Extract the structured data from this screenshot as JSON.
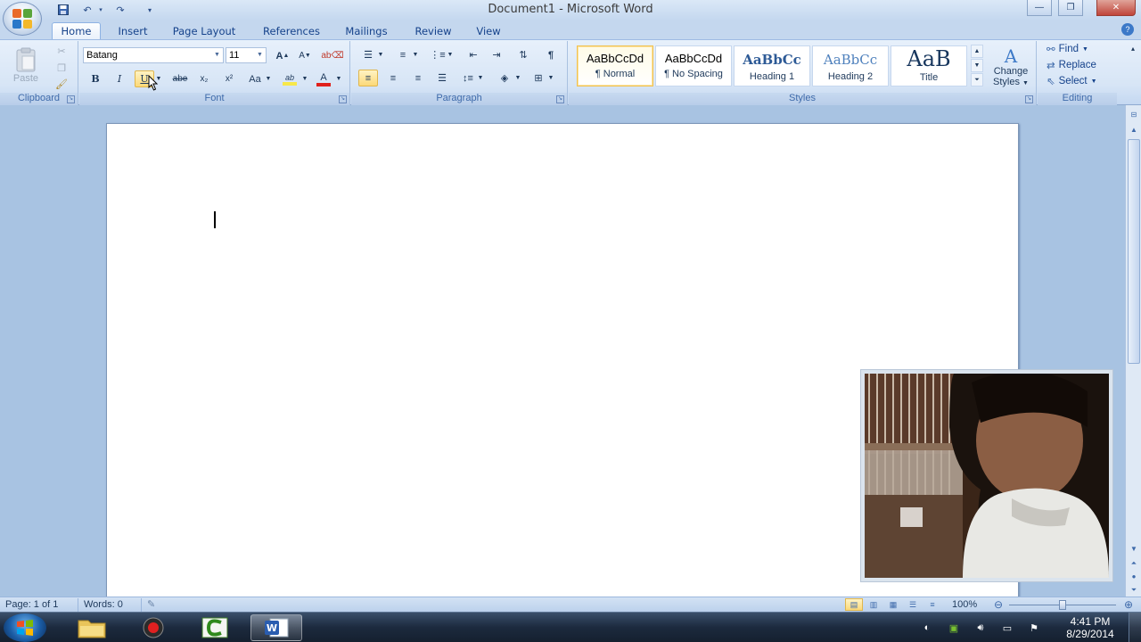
{
  "window": {
    "title": "Document1 - Microsoft Word",
    "minimize_glyph": "—",
    "restore_glyph": "❐",
    "close_glyph": "✕"
  },
  "quick_access": {
    "save_icon": "save-icon",
    "undo_icon": "undo-icon",
    "redo_icon": "redo-icon",
    "customize_icon": "chevron-down-icon"
  },
  "tabs": [
    "Home",
    "Insert",
    "Page Layout",
    "References",
    "Mailings",
    "Review",
    "View"
  ],
  "ribbon": {
    "clipboard": {
      "label": "Clipboard",
      "paste": "Paste"
    },
    "font": {
      "label": "Font",
      "font_name": "Batang",
      "font_size": "11",
      "bold": "B",
      "italic": "I",
      "underline": "U",
      "strike": "abe",
      "subscript": "x₂",
      "superscript": "x²",
      "change_case": "Aa",
      "grow": "A",
      "shrink": "A",
      "font_color_accent": "#e0201b",
      "highlight_accent": "#f7e84a"
    },
    "paragraph": {
      "label": "Paragraph",
      "show_marks": "¶"
    },
    "styles": {
      "label": "Styles",
      "items": [
        {
          "sample": "AaBbCcDd",
          "name": "¶ Normal",
          "selected": true
        },
        {
          "sample": "AaBbCcDd",
          "name": "¶ No Spacing",
          "selected": false
        },
        {
          "sample": "AaBbCc",
          "name": "Heading 1",
          "selected": false
        },
        {
          "sample": "AaBbCc",
          "name": "Heading 2",
          "selected": false
        },
        {
          "sample": "AaB",
          "name": "Title",
          "selected": false
        }
      ],
      "change_styles_line1": "Change",
      "change_styles_line2": "Styles"
    },
    "editing": {
      "label": "Editing",
      "find": "Find",
      "replace": "Replace",
      "select": "Select"
    }
  },
  "statusbar": {
    "page": "Page: 1 of 1",
    "words": "Words: 0",
    "zoom": "100%"
  },
  "taskbar": {
    "apps": [
      "explorer",
      "recorder",
      "camtasia",
      "word"
    ],
    "clock_time": "4:41 PM",
    "clock_date": "8/29/2014"
  },
  "colors": {
    "ribbon_bg": "#dbe7f6",
    "accent": "#15428b",
    "selected_style_border": "#f2c14e"
  }
}
